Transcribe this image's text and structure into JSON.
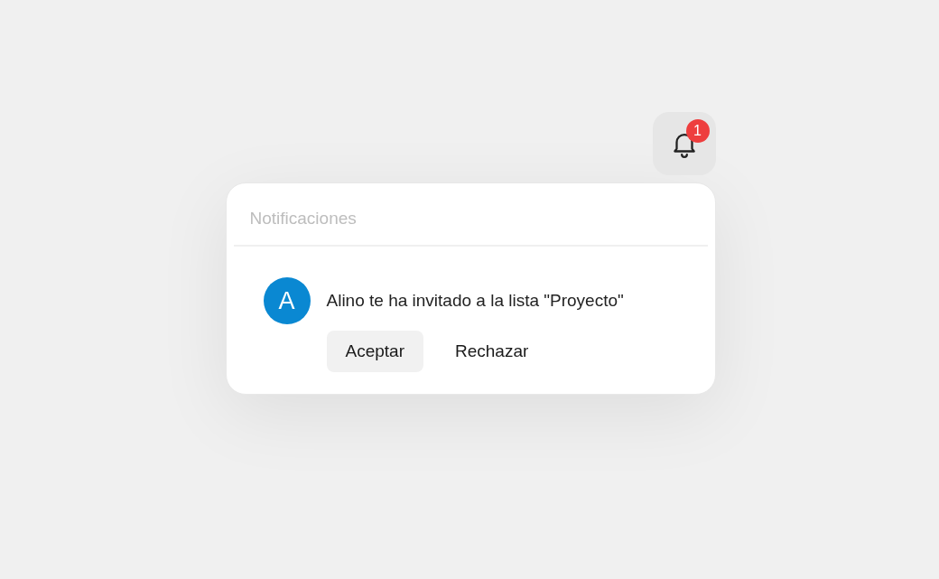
{
  "bell": {
    "badge": "1"
  },
  "panel": {
    "title": "Notificaciones",
    "notifications": [
      {
        "avatar": "A",
        "color": "#0a88d2",
        "message": "Alino te ha invitado a la lista \"Proyecto\"",
        "actions": [
          {
            "label": "Aceptar",
            "kind": "filled"
          },
          {
            "label": "Rechazar",
            "kind": "plain"
          }
        ]
      }
    ]
  }
}
